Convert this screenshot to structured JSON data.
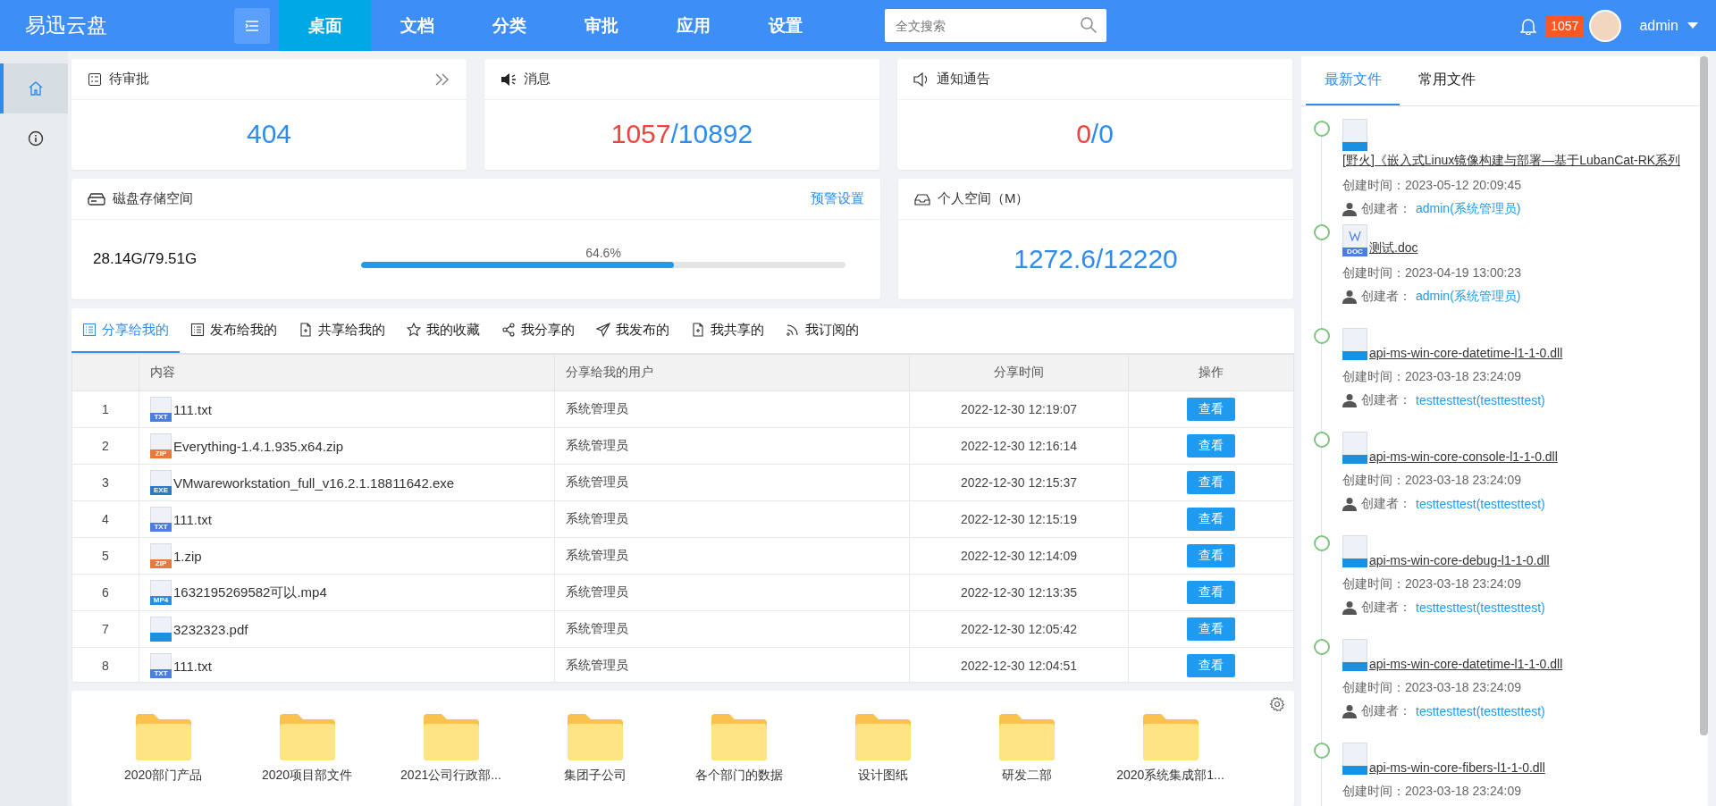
{
  "header": {
    "logo": "易迅云盘",
    "nav": [
      {
        "label": "桌面",
        "selected": true
      },
      {
        "label": "文档",
        "selected": false
      },
      {
        "label": "分类",
        "selected": false
      },
      {
        "label": "审批",
        "selected": false
      },
      {
        "label": "应用",
        "selected": false
      },
      {
        "label": "设置",
        "selected": false
      }
    ],
    "search": {
      "placeholder": "全文搜索"
    },
    "notification_count": "1057",
    "user": "admin"
  },
  "sidebar": [
    {
      "kind": "home",
      "selected": true
    },
    {
      "kind": "info",
      "selected": false
    }
  ],
  "cards": {
    "pending": {
      "title": "待审批",
      "value": "404"
    },
    "messages": {
      "title": "消息",
      "unread": "1057",
      "separator": "/",
      "total": "10892"
    },
    "notices": {
      "title": "通知通告",
      "unread": "0",
      "separator": "/",
      "total": "0"
    },
    "disk": {
      "title": "磁盘存储空间",
      "link": "预警设置",
      "usage": "28.14G/79.51G",
      "reading": "64.6%",
      "level": 0.646
    },
    "personal": {
      "title": "个人空间（M）",
      "value": "1272.6/12220"
    }
  },
  "share_tabs": [
    {
      "label": "分享给我的",
      "kind": "list",
      "selected": true
    },
    {
      "label": "发布给我的",
      "kind": "doclist",
      "selected": false
    },
    {
      "label": "共享给我的",
      "kind": "page",
      "selected": false
    },
    {
      "label": "我的收藏",
      "kind": "star",
      "selected": false
    },
    {
      "label": "我分享的",
      "kind": "share",
      "selected": false
    },
    {
      "label": "我发布的",
      "kind": "send",
      "selected": false
    },
    {
      "label": "我共享的",
      "kind": "page",
      "selected": false
    },
    {
      "label": "我订阅的",
      "kind": "rss",
      "selected": false
    }
  ],
  "table": {
    "columns": [
      "内容",
      "分享给我的用户",
      "分享时间",
      "操作"
    ],
    "rows": [
      {
        "index": "1",
        "file": "111.txt",
        "kind": "txt",
        "badge": "TXT",
        "user": "系统管理员",
        "time": "2022-12-30 12:19:07",
        "action": "查看"
      },
      {
        "index": "2",
        "file": "Everything-1.4.1.935.x64.zip",
        "kind": "zip",
        "badge": "ZIP",
        "user": "系统管理员",
        "time": "2022-12-30 12:16:14",
        "action": "查看"
      },
      {
        "index": "3",
        "file": "VMwareworkstation_full_v16.2.1.18811642.exe",
        "kind": "exe",
        "badge": "EXE",
        "user": "系统管理员",
        "time": "2022-12-30 12:15:37",
        "action": "查看"
      },
      {
        "index": "4",
        "file": "111.txt",
        "kind": "txt",
        "badge": "TXT",
        "user": "系统管理员",
        "time": "2022-12-30 12:15:19",
        "action": "查看"
      },
      {
        "index": "5",
        "file": "1.zip",
        "kind": "zip",
        "badge": "ZIP",
        "user": "系统管理员",
        "time": "2022-12-30 12:14:09",
        "action": "查看"
      },
      {
        "index": "6",
        "file": "1632195269582可以.mp4",
        "kind": "mp4",
        "badge": "MP4",
        "user": "系统管理员",
        "time": "2022-12-30 12:13:35",
        "action": "查看"
      },
      {
        "index": "7",
        "file": "3232323.pdf",
        "kind": "blank",
        "user": "系统管理员",
        "time": "2022-12-30 12:05:42",
        "action": "查看"
      },
      {
        "index": "8",
        "file": "111.txt",
        "kind": "txt",
        "badge": "TXT",
        "user": "系统管理员",
        "time": "2022-12-30 12:04:51",
        "action": "查看"
      }
    ]
  },
  "folders": [
    "2020部门产品",
    "2020项目部文件",
    "2021公司行政部...",
    "集团子公司",
    "各个部门的数据",
    "设计图纸",
    "研发二部",
    "2020系统集成部1..."
  ],
  "files_panel": {
    "tabs": [
      {
        "label": "最新文件",
        "selected": true
      },
      {
        "label": "常用文件",
        "selected": false
      }
    ],
    "items": [
      {
        "name": "[野火]《嵌入式Linux镜像构建与部署—基于LubanCat-RK系列",
        "kind": "blank",
        "created_label": "创建时间：",
        "created": "2023-05-12 20:09:45",
        "creator_label": "创建者：",
        "creator": "admin(系统管理员)"
      },
      {
        "name": "测试.doc",
        "kind": "doc",
        "badge": "DOC",
        "created_label": "创建时间：",
        "created": "2023-04-19 13:00:23",
        "creator_label": "创建者：",
        "creator": "admin(系统管理员)"
      },
      {
        "name": "api-ms-win-core-datetime-l1-1-0.dll",
        "kind": "blank",
        "created_label": "创建时间：",
        "created": "2023-03-18 23:24:09",
        "creator_label": "创建者：",
        "creator": "testtesttest(testtesttest)"
      },
      {
        "name": "api-ms-win-core-console-l1-1-0.dll",
        "kind": "blank",
        "created_label": "创建时间：",
        "created": "2023-03-18 23:24:09",
        "creator_label": "创建者：",
        "creator": "testtesttest(testtesttest)"
      },
      {
        "name": "api-ms-win-core-debug-l1-1-0.dll",
        "kind": "blank",
        "created_label": "创建时间：",
        "created": "2023-03-18 23:24:09",
        "creator_label": "创建者：",
        "creator": "testtesttest(testtesttest)"
      },
      {
        "name": "api-ms-win-core-datetime-l1-1-0.dll",
        "kind": "blank",
        "created_label": "创建时间：",
        "created": "2023-03-18 23:24:09",
        "creator_label": "创建者：",
        "creator": "testtesttest(testtesttest)"
      },
      {
        "name": "api-ms-win-core-fibers-l1-1-0.dll",
        "kind": "blank",
        "created_label": "创建时间：",
        "created": "2023-03-18 23:24:09"
      }
    ]
  }
}
